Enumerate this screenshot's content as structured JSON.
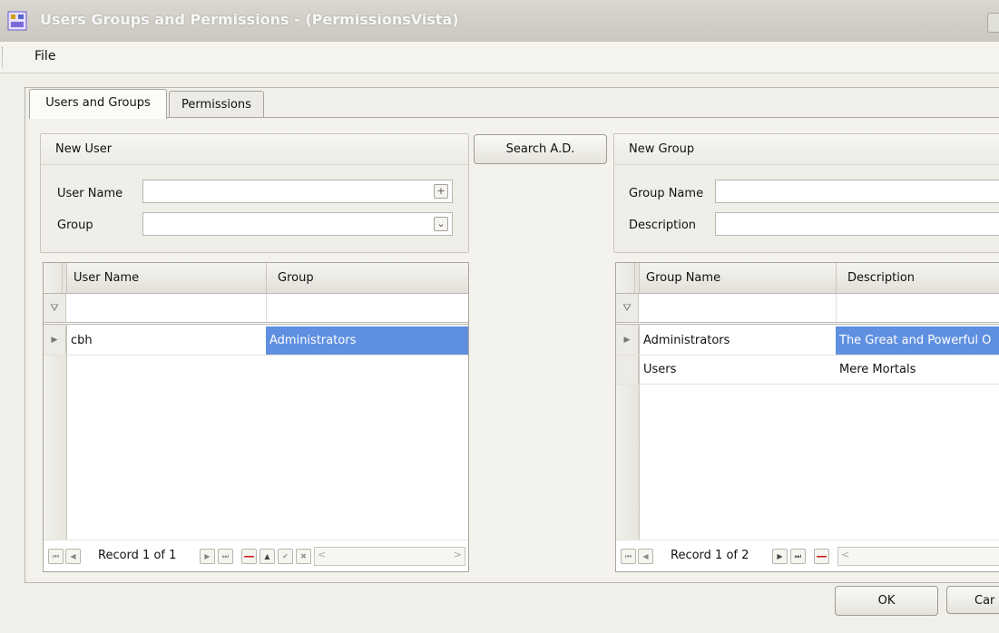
{
  "window": {
    "title": "Users Groups and Permissions - (PermissionsVista)"
  },
  "menu": {
    "file": "File"
  },
  "tabs": [
    {
      "label": "Users and Groups",
      "active": true
    },
    {
      "label": "Permissions",
      "active": false
    }
  ],
  "new_user": {
    "header": "New User",
    "user_name_label": "User Name",
    "group_label": "Group",
    "user_name_value": "",
    "group_value": ""
  },
  "search_ad_button": "Search A.D.",
  "new_group": {
    "header": "New Group",
    "group_name_label": "Group Name",
    "description_label": "Description",
    "group_name_value": "",
    "description_value": ""
  },
  "users_grid": {
    "columns": [
      "User Name",
      "Group"
    ],
    "rows": [
      {
        "user": "cbh",
        "group": "Administrators"
      }
    ],
    "record_text": "Record 1 of 1"
  },
  "groups_grid": {
    "columns": [
      "Group Name",
      "Description"
    ],
    "rows": [
      {
        "name": "Administrators",
        "description": "The Great and Powerful O"
      },
      {
        "name": "Users",
        "description": "Mere Mortals"
      }
    ],
    "record_text": "Record 1 of 2"
  },
  "buttons": {
    "ok": "OK",
    "cancel": "Car"
  },
  "colors": {
    "selection": "#5f8fe0",
    "window_bg": "#f0efe9",
    "delete_red": "#cc1c1c"
  },
  "icons": [
    "app-icon",
    "filter-icon",
    "row-pointer-icon",
    "plus-icon",
    "dropdown-icon",
    "first-icon",
    "prev-icon",
    "next-icon",
    "last-icon",
    "delete-icon",
    "up-icon",
    "check-icon",
    "cancel-icon"
  ]
}
